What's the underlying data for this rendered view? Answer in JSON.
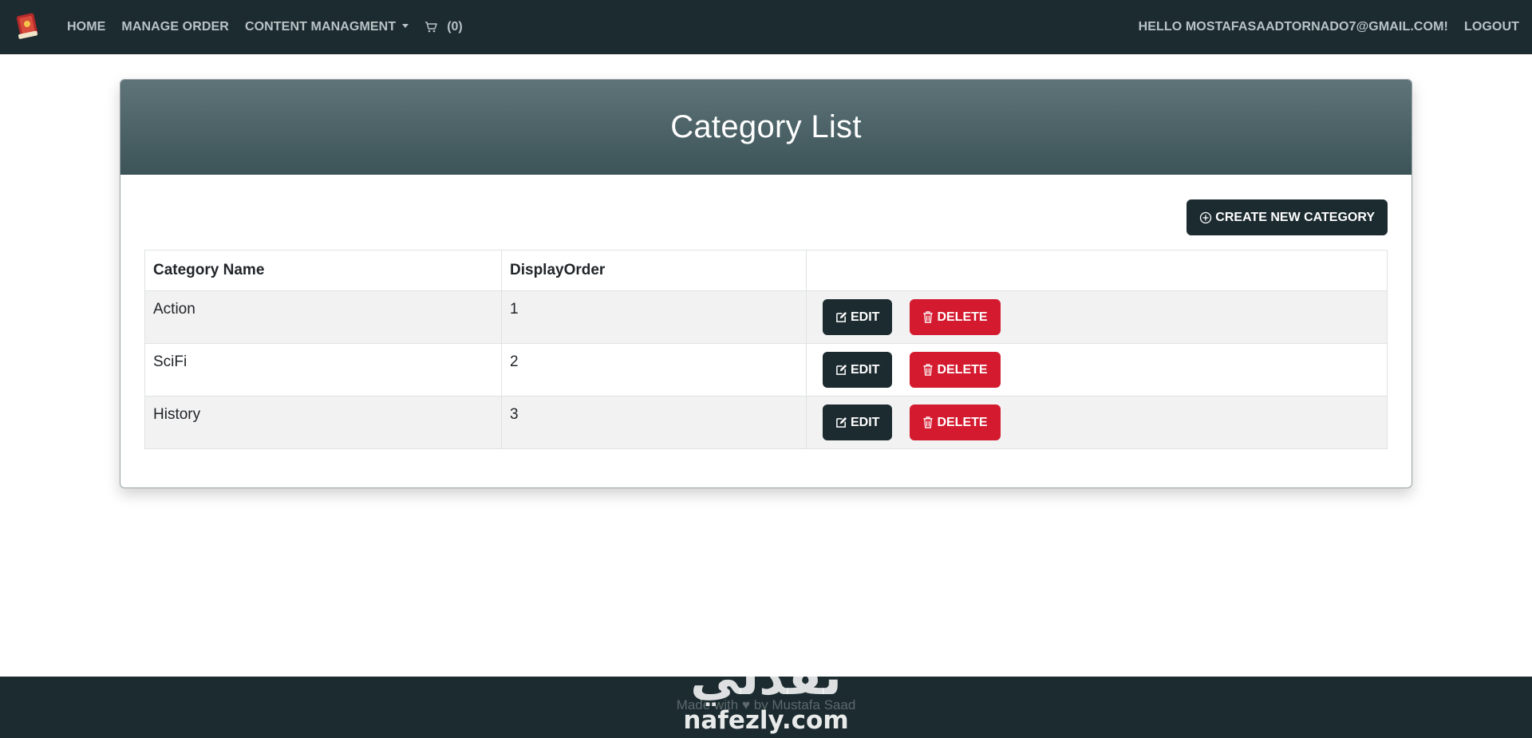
{
  "navbar": {
    "logo_icon": "book-icon",
    "links": [
      "HOME",
      "MANAGE ORDER",
      "CONTENT MANAGMENT"
    ],
    "cart_label": "(0)",
    "greeting": "HELLO MOSTAFASAADTORNADO7@GMAIL.COM!",
    "logout": "LOGOUT"
  },
  "card": {
    "title": "Category List",
    "create_button": "CREATE NEW CATEGORY"
  },
  "table": {
    "headers": [
      "Category Name",
      "DisplayOrder",
      ""
    ],
    "rows": [
      {
        "name": "Action",
        "order": "1"
      },
      {
        "name": "SciFi",
        "order": "2"
      },
      {
        "name": "History",
        "order": "3"
      }
    ],
    "edit_label": "EDIT",
    "delete_label": "DELETE"
  },
  "footer": {
    "text": "Made with ♥ by Mustafa Saad"
  },
  "watermark": {
    "arabic": "نفذلي",
    "latin": "nafezly.com"
  },
  "colors": {
    "navbar": "#1c2b30",
    "header_top": "#5e7479",
    "header_bottom": "#3c5358",
    "delete": "#d41a2f"
  }
}
